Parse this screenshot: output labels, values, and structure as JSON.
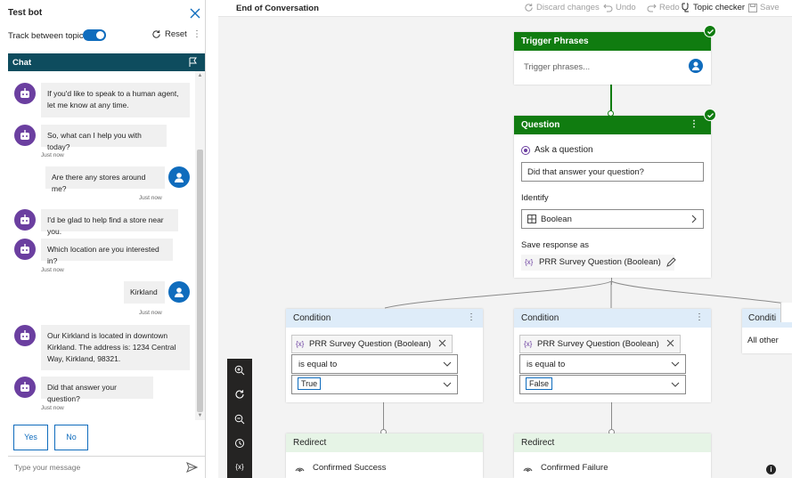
{
  "left_panel": {
    "title": "Test bot",
    "track_label": "Track between topics",
    "track_on": true,
    "reset_label": "Reset",
    "chat_label": "Chat",
    "messages": [
      {
        "from": "bot",
        "text": "If you'd like to speak to a human agent, let me know at any time."
      },
      {
        "from": "bot",
        "text": "So, what can I help you with today?",
        "time": "Just now"
      },
      {
        "from": "user",
        "text": "Are there any stores around me?",
        "time": "Just now"
      },
      {
        "from": "bot",
        "text": "I'd be glad to help find a store near you."
      },
      {
        "from": "bot",
        "text": "Which location are you interested in?",
        "time": "Just now"
      },
      {
        "from": "user",
        "text": "Kirkland",
        "time": "Just now"
      },
      {
        "from": "bot",
        "text": "Our Kirkland is located in downtown Kirkland. The address is: 1234 Central Way, Kirkland, 98321."
      },
      {
        "from": "bot",
        "text": "Did that answer your question?",
        "time": "Just now"
      }
    ],
    "choices": [
      "Yes",
      "No"
    ],
    "input_placeholder": "Type your message"
  },
  "toolbar": {
    "page_title": "End of Conversation",
    "discard": "Discard changes",
    "undo": "Undo",
    "redo": "Redo",
    "topic_checker": "Topic checker",
    "save": "Save"
  },
  "canvas": {
    "trigger": {
      "title": "Trigger Phrases",
      "placeholder": "Trigger phrases..."
    },
    "question": {
      "title": "Question",
      "ask_label": "Ask a question",
      "prompt": "Did that answer your question?",
      "identify_label": "Identify",
      "identify_value": "Boolean",
      "save_label": "Save response as",
      "variable": "PRR Survey Question (Boolean)",
      "var_icon": "{x}"
    },
    "conditions": [
      {
        "title": "Condition",
        "variable": "PRR Survey Question (Boolean)",
        "operator": "is equal to",
        "value": "True"
      },
      {
        "title": "Condition",
        "variable": "PRR Survey Question (Boolean)",
        "operator": "is equal to",
        "value": "False"
      },
      {
        "title": "Conditi",
        "value": "All other"
      }
    ],
    "redirects": [
      {
        "title": "Redirect",
        "target": "Confirmed Success"
      },
      {
        "title": "Redirect",
        "target": "Confirmed Failure"
      }
    ],
    "zoom_var_icon": "{x}"
  },
  "colors": {
    "green": "#107c10",
    "blue": "#0f6cbd",
    "purple": "#6b3fa0",
    "chat_header": "#0e4c5e",
    "condition_bg": "#deecf9",
    "redirect_bg": "#e6f4e6"
  }
}
